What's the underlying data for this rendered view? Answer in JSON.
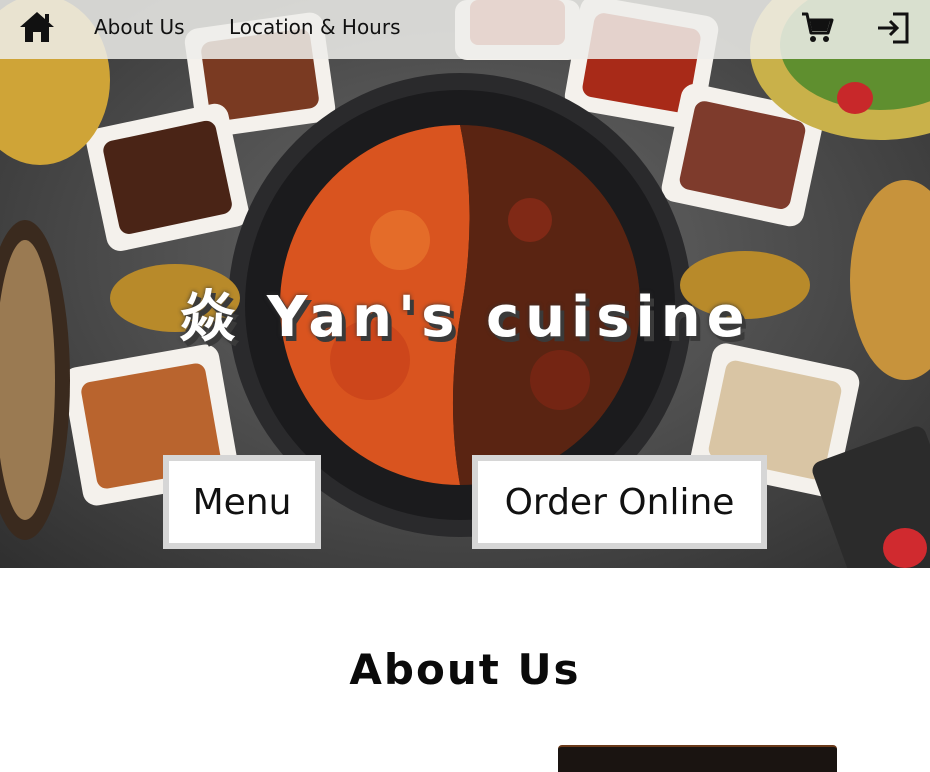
{
  "nav": {
    "home_icon": "home-icon",
    "about_label": "About Us",
    "location_label": "Location & Hours",
    "cart_icon": "cart-icon",
    "login_icon": "login-icon"
  },
  "hero": {
    "brand_title": "焱 Yan's cuisine",
    "menu_label": "Menu",
    "order_label": "Order Online"
  },
  "about": {
    "heading": "About Us"
  },
  "colors": {
    "nav_background": "#eeeeea",
    "button_background": "#ffffff",
    "button_border": "#d6d6d6",
    "soup_red": "#d9541f",
    "soup_dark": "#5a2412"
  }
}
